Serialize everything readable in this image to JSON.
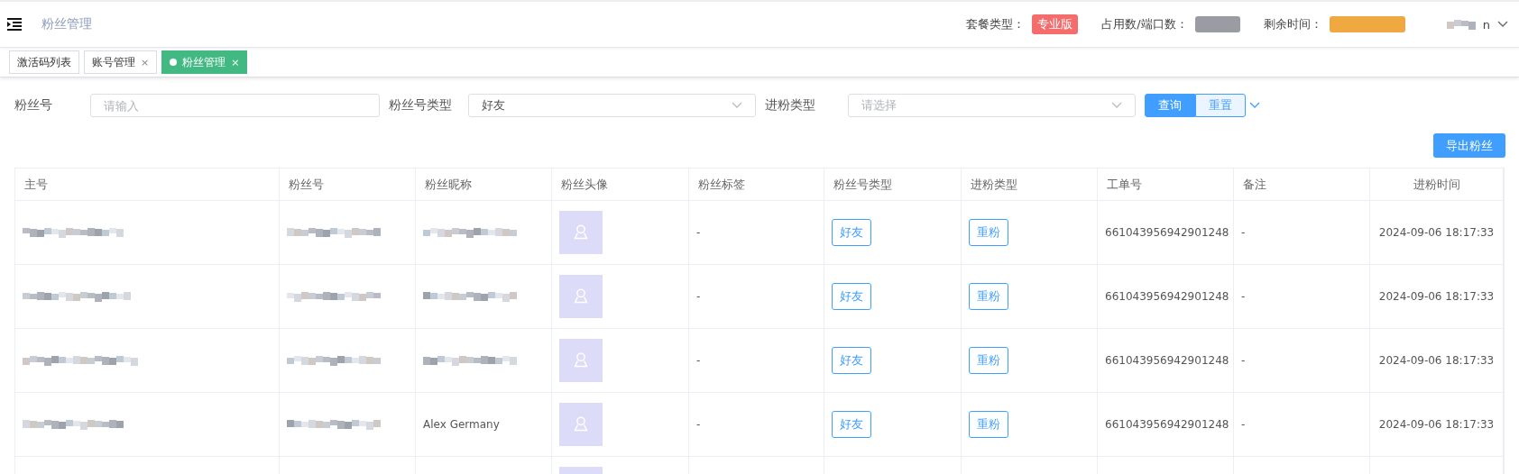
{
  "header": {
    "title": "粉丝管理",
    "plan_label": "套餐类型：",
    "plan_badge": "专业版",
    "usage_label": "占用数/端口数：",
    "remaining_label": "剩余时间：",
    "user_suffix": "n"
  },
  "tabs": [
    {
      "label": "激活码列表",
      "selected": false,
      "closable": false
    },
    {
      "label": "账号管理",
      "selected": false,
      "closable": true
    },
    {
      "label": "粉丝管理",
      "selected": true,
      "closable": true
    }
  ],
  "tab_close": "×",
  "filters": [
    {
      "kind": "input",
      "label": "粉丝号",
      "placeholder": "请输入"
    },
    {
      "kind": "select",
      "label": "粉丝号类型",
      "value": "好友"
    },
    {
      "kind": "select",
      "label": "进粉类型",
      "placeholder": "请选择"
    }
  ],
  "buttons": {
    "search": "查询",
    "reset": "重置",
    "export": "导出粉丝"
  },
  "table": {
    "columns": [
      "主号",
      "粉丝号",
      "粉丝昵称",
      "粉丝头像",
      "粉丝标签",
      "粉丝号类型",
      "进粉类型",
      "工单号",
      "备注",
      "进粉时间"
    ],
    "rows": [
      {
        "tag": "-",
        "fan_type": "好友",
        "entry_type": "重粉",
        "ticket": "661043956942901248",
        "note": "-",
        "time": "2024-09-06 18:17:33"
      },
      {
        "tag": "-",
        "fan_type": "好友",
        "entry_type": "重粉",
        "ticket": "661043956942901248",
        "note": "-",
        "time": "2024-09-06 18:17:33"
      },
      {
        "tag": "-",
        "fan_type": "好友",
        "entry_type": "重粉",
        "ticket": "661043956942901248",
        "note": "-",
        "time": "2024-09-06 18:17:33"
      },
      {
        "nickname": "Alex Germany",
        "tag": "-",
        "fan_type": "好友",
        "entry_type": "重粉",
        "ticket": "661043956942901248",
        "note": "-",
        "time": "2024-09-06 18:17:33"
      }
    ]
  }
}
